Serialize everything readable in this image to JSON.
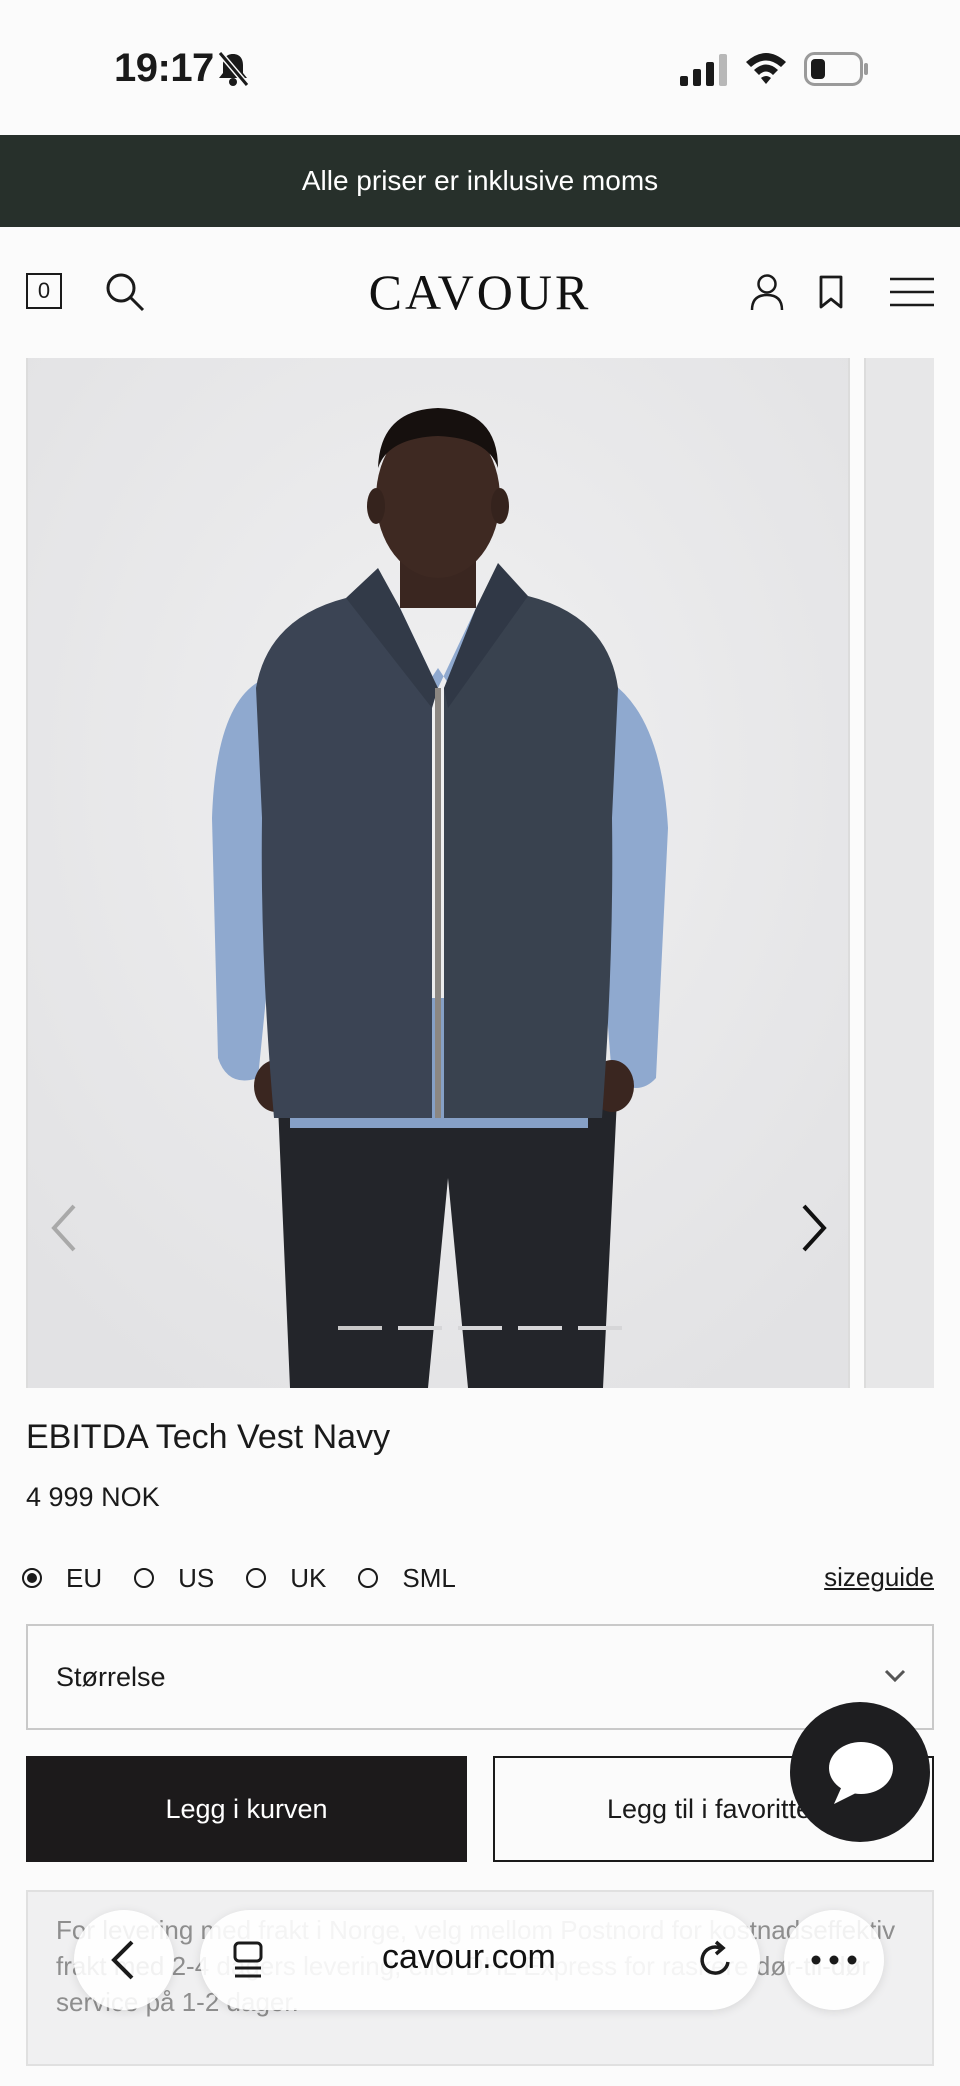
{
  "status_bar": {
    "time": "19:17"
  },
  "banner": {
    "text": "Alle priser er inklusive moms"
  },
  "header": {
    "cart_count": "0",
    "logo": "CAVOUR"
  },
  "product": {
    "title": "EBITDA Tech Vest Navy",
    "price": "4 999 NOK",
    "gallery": {
      "current": 1,
      "total": 5
    },
    "size_systems": [
      {
        "label": "EU",
        "selected": true
      },
      {
        "label": "US",
        "selected": false
      },
      {
        "label": "UK",
        "selected": false
      },
      {
        "label": "SML",
        "selected": false
      }
    ],
    "sizeguide_label": "sizeguide",
    "size_select_label": "Størrelse",
    "add_to_cart_label": "Legg i kurven",
    "add_to_favorites_label": "Legg til i favoritter"
  },
  "shipping": {
    "text": "For levering med frakt i Norge, velg mellom Postnord for kostnadseffektiv frakt med 2-4 dagers levering, eller DHL Express for raskere dør-til-dør service på 1-2 dager."
  },
  "browser": {
    "url": "cavour.com"
  },
  "colors": {
    "banner": "#27302b",
    "primary_button": "#1c1a1b",
    "vest": "#3b4454",
    "shirt": "#8fa9cf"
  }
}
